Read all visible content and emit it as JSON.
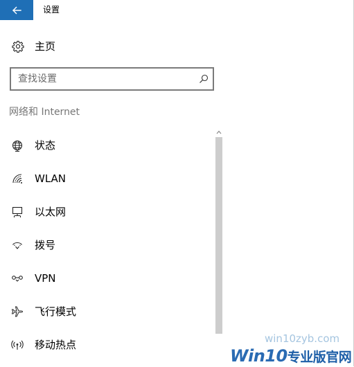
{
  "window": {
    "title": "设置"
  },
  "home": {
    "label": "主页",
    "icon": "gear-icon"
  },
  "search": {
    "placeholder": "查找设置",
    "value": "",
    "icon": "search-icon"
  },
  "section": {
    "heading": "网络和 Internet"
  },
  "nav_items": [
    {
      "label": "状态",
      "icon": "globe-icon"
    },
    {
      "label": "WLAN",
      "icon": "wifi-icon"
    },
    {
      "label": "以太网",
      "icon": "ethernet-icon"
    },
    {
      "label": "拨号",
      "icon": "dialup-icon"
    },
    {
      "label": "VPN",
      "icon": "vpn-icon"
    },
    {
      "label": "飞行模式",
      "icon": "airplane-icon"
    },
    {
      "label": "移动热点",
      "icon": "hotspot-icon"
    }
  ],
  "watermark": {
    "url": "win10zyb.com",
    "brand": "Win10",
    "brand_suffix": "专业版官网"
  },
  "colors": {
    "accent": "#1f6fb6",
    "heading_gray": "#767676",
    "scrollbar_thumb": "#cdcdcd"
  }
}
